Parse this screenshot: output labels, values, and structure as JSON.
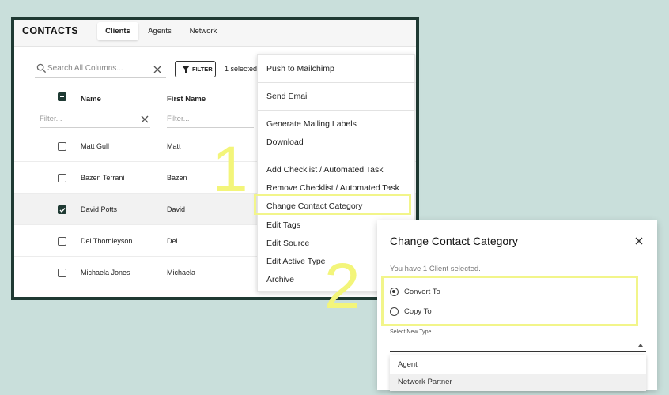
{
  "app": {
    "title": "CONTACTS",
    "tabs": [
      {
        "label": "Clients",
        "active": true
      },
      {
        "label": "Agents",
        "active": false
      },
      {
        "label": "Network",
        "active": false
      }
    ]
  },
  "toolbar": {
    "search_placeholder": "Search All Columns...",
    "filter_label": "FILTER",
    "selected_count": "1 selected"
  },
  "table": {
    "columns": [
      "Name",
      "First Name"
    ],
    "filter_placeholder": "Filter...",
    "rows": [
      {
        "name": "Matt Gull",
        "first": "Matt",
        "checked": false
      },
      {
        "name": "Bazen Terrani",
        "first": "Bazen",
        "checked": false
      },
      {
        "name": "David Potts",
        "first": "David",
        "checked": true
      },
      {
        "name": "Del Thornleyson",
        "first": "Del",
        "checked": false
      },
      {
        "name": "Michaela Jones",
        "first": "Michaela",
        "checked": false
      }
    ]
  },
  "menu": {
    "items": [
      "Push to Mailchimp",
      "Send Email",
      "Generate Mailing Labels",
      "Download",
      "Add Checklist / Automated Task",
      "Remove Checklist / Automated Task",
      "Change Contact Category",
      "Edit Tags",
      "Edit Source",
      "Edit Active Type",
      "Archive"
    ]
  },
  "annotations": {
    "step1": "1",
    "step2": "2",
    "highlight_color": "#f2f58a"
  },
  "dialog": {
    "title": "Change Contact Category",
    "subtitle": "You have 1 Client selected.",
    "options": [
      {
        "label": "Convert To",
        "selected": true
      },
      {
        "label": "Copy To",
        "selected": false
      }
    ],
    "select_label": "Select New Type",
    "type_options": [
      "Agent",
      "Network Partner"
    ]
  },
  "colors": {
    "accent": "#1f3a33",
    "background": "#c9dfdb"
  }
}
